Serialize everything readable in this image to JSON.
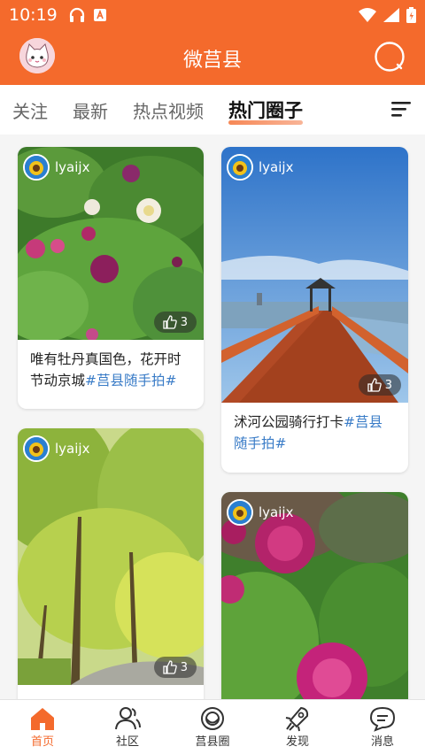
{
  "status": {
    "time": "10:19"
  },
  "header": {
    "title": "微莒县"
  },
  "tabs": [
    {
      "label": "关注"
    },
    {
      "label": "最新"
    },
    {
      "label": "热点视频"
    },
    {
      "label": "热门圈子"
    }
  ],
  "cards": [
    {
      "user": "lyaijx",
      "likes": "3",
      "caption_text": "唯有牡丹真国色，花开时节动京城",
      "caption_tag": "#莒县随手拍#"
    },
    {
      "user": "lyaijx",
      "likes": "3",
      "caption_text": "沭河公园骑行打卡",
      "caption_tag": "#莒县随手拍#"
    },
    {
      "user": "lyaijx",
      "likes": "3"
    },
    {
      "user": "lyaijx"
    }
  ],
  "nav": [
    {
      "label": "首页",
      "icon": "home-icon"
    },
    {
      "label": "社区",
      "icon": "community-icon"
    },
    {
      "label": "莒县圈",
      "icon": "circle-icon"
    },
    {
      "label": "发现",
      "icon": "rocket-icon"
    },
    {
      "label": "消息",
      "icon": "message-icon"
    }
  ],
  "colors": {
    "brand": "#f46a2c",
    "tag": "#3a7cc7"
  }
}
